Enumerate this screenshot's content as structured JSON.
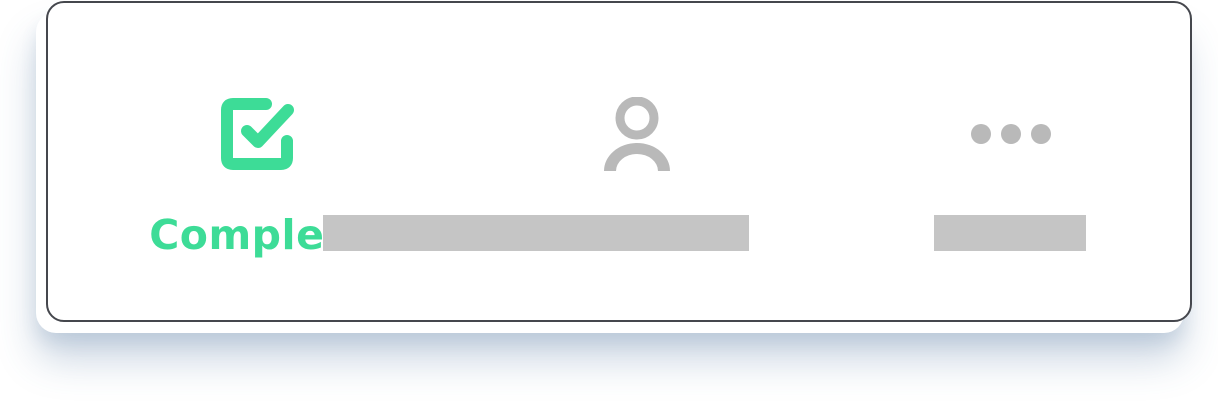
{
  "tabs": [
    {
      "id": "complete",
      "label": "Complete",
      "icon": "checkbox-checked-icon",
      "selected": true,
      "color": "#3ddc97"
    },
    {
      "id": "profile",
      "label": "",
      "icon": "person-icon",
      "selected": false,
      "color": "#b9b9b9"
    },
    {
      "id": "more",
      "label": "",
      "icon": "more-horizontal-icon",
      "selected": false,
      "color": "#b9b9b9"
    }
  ],
  "placeholder_color": "#c5c5c5"
}
